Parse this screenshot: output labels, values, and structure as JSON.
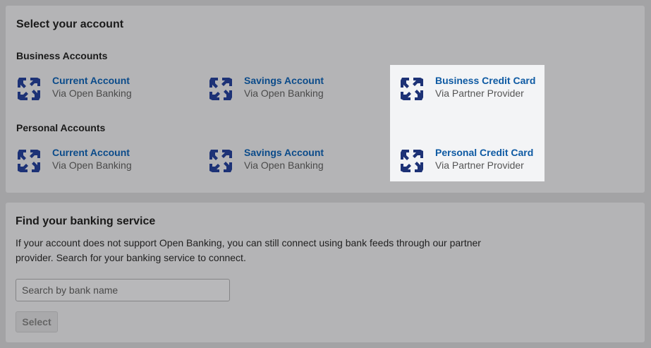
{
  "accounts_panel": {
    "title": "Select your account",
    "business": {
      "heading": "Business Accounts",
      "items": [
        {
          "name": "Current Account",
          "via": "Via Open Banking",
          "icon": "bank-logo-icon"
        },
        {
          "name": "Savings Account",
          "via": "Via Open Banking",
          "icon": "bank-logo-icon"
        },
        {
          "name": "Business Credit Card",
          "via": "Via Partner Provider",
          "icon": "bank-logo-icon"
        }
      ]
    },
    "personal": {
      "heading": "Personal Accounts",
      "items": [
        {
          "name": "Current Account",
          "via": "Via Open Banking",
          "icon": "bank-logo-icon"
        },
        {
          "name": "Savings Account",
          "via": "Via Open Banking",
          "icon": "bank-logo-icon"
        },
        {
          "name": "Personal Credit Card",
          "via": "Via Partner Provider",
          "icon": "bank-logo-icon"
        }
      ]
    }
  },
  "find_panel": {
    "title": "Find your banking service",
    "description": "If your account does not support Open Banking, you can still connect using bank feeds through our partner provider. Search for your banking service to connect.",
    "search_placeholder": "Search by bank name",
    "search_value": "",
    "select_label": "Select"
  },
  "colors": {
    "logo": "#1d3276",
    "link": "#0b4b8a",
    "highlight": "#f3f4f6"
  }
}
